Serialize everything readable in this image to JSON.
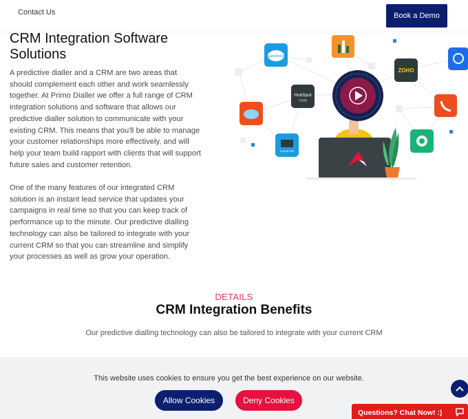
{
  "header": {
    "nav_contact": "Contact Us",
    "cta": "Book a Demo"
  },
  "main": {
    "title": "CRM Integration Software Solutions",
    "paragraph1": "A predictive dialler and a CRM are two areas that should complement each other and work seamlessly together. At Primo Dialler we offer a full range of CRM integration solutions and software that allows our predictive dialler solution to communicate with your existing CRM. This means that you'll be able to manage your customer relationships more effectively, and will help your team build rapport with clients that will support future sales and customer retention.",
    "paragraph2": "One of the many features of our integrated CRM solution is an instant lead service that updates your campaigns in real time so that you can keep track of performance up to the minute. Our predictive dialling technology can also be tailored to integrate with your current CRM so that you can streamline and simplify your processes as well as grow your operation."
  },
  "illustration": {
    "salesforce": "salesforce",
    "zoho": "ZOHO",
    "hubspot": "HubSpot",
    "hubspot_sub": "CRM",
    "sugar": "SUGARCRM"
  },
  "details": {
    "kicker": "DETAILS",
    "title": "CRM Integration Benefits",
    "subtitle": "Our predictive dialling technology can also be tailored to integrate with your current CRM"
  },
  "cookie": {
    "message": "This website uses cookies to ensure you get the best experience on our website.",
    "allow": "Allow Cookies",
    "deny": "Deny Cookies"
  },
  "chat": {
    "label": "Questions? Chat Now! :)"
  },
  "colors": {
    "navy": "#0b1f6e",
    "accent_red": "#e8103e",
    "chat_red": "#e31b1b"
  }
}
